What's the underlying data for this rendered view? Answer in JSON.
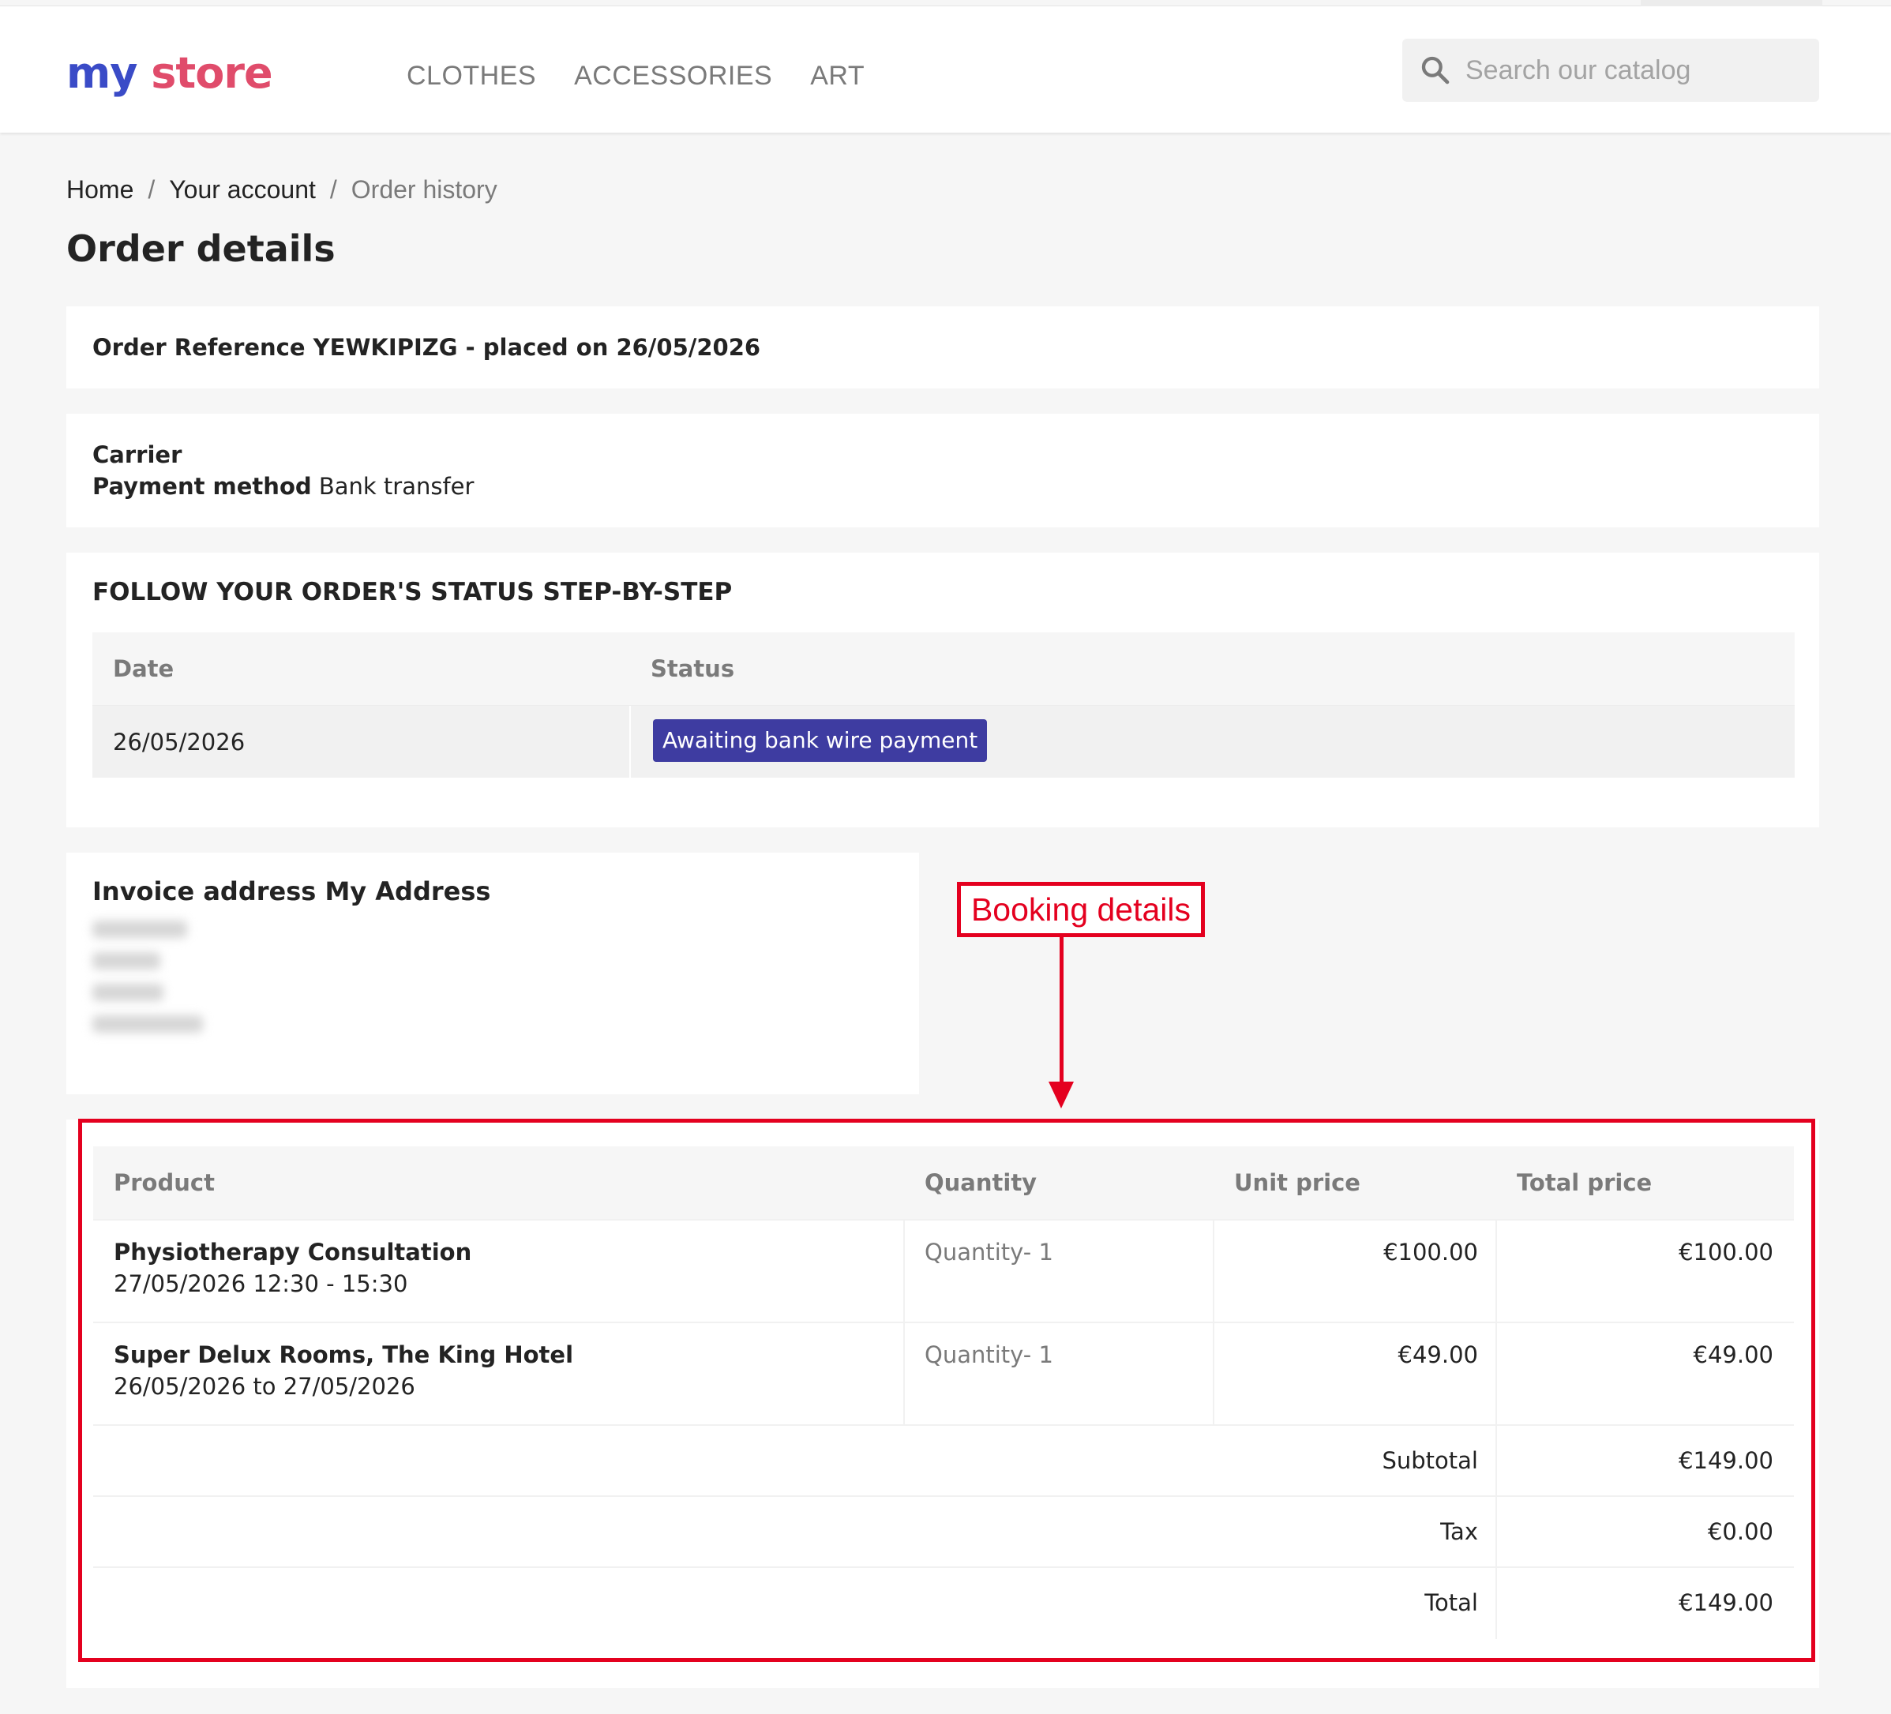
{
  "header": {
    "logo": {
      "word1": "my",
      "word2": "store"
    },
    "nav": [
      "CLOTHES",
      "ACCESSORIES",
      "ART"
    ],
    "search": {
      "placeholder": "Search our catalog"
    }
  },
  "breadcrumb": {
    "home": "Home",
    "account": "Your account",
    "current": "Order history",
    "separator": "/"
  },
  "page_title": "Order details",
  "order_reference": "Order Reference YEWKIPIZG - placed on 26/05/2026",
  "carrier": {
    "carrier_label": "Carrier",
    "payment_label": "Payment method",
    "payment_value": "Bank transfer"
  },
  "status_section": {
    "title": "FOLLOW YOUR ORDER'S STATUS STEP-BY-STEP",
    "col_date": "Date",
    "col_status": "Status",
    "rows": [
      {
        "date": "26/05/2026",
        "status": "Awaiting bank wire payment"
      }
    ],
    "badge_color": "#3e3ca1"
  },
  "invoice": {
    "title": "Invoice address My Address"
  },
  "annotation": {
    "label": "Booking details",
    "color": "#e4001f"
  },
  "products": {
    "columns": {
      "product": "Product",
      "quantity": "Quantity",
      "unit_price": "Unit price",
      "total_price": "Total price"
    },
    "rows": [
      {
        "name": "Physiotherapy Consultation",
        "detail": "27/05/2026 12:30 - 15:30",
        "quantity": "Quantity- 1",
        "unit_price": "€100.00",
        "total_price": "€100.00"
      },
      {
        "name": "Super Delux Rooms, The King Hotel",
        "detail": "26/05/2026 to 27/05/2026",
        "quantity": "Quantity- 1",
        "unit_price": "€49.00",
        "total_price": "€49.00"
      }
    ],
    "totals": [
      {
        "label": "Subtotal",
        "value": "€149.00"
      },
      {
        "label": "Tax",
        "value": "€0.00"
      },
      {
        "label": "Total",
        "value": "€149.00"
      }
    ]
  }
}
